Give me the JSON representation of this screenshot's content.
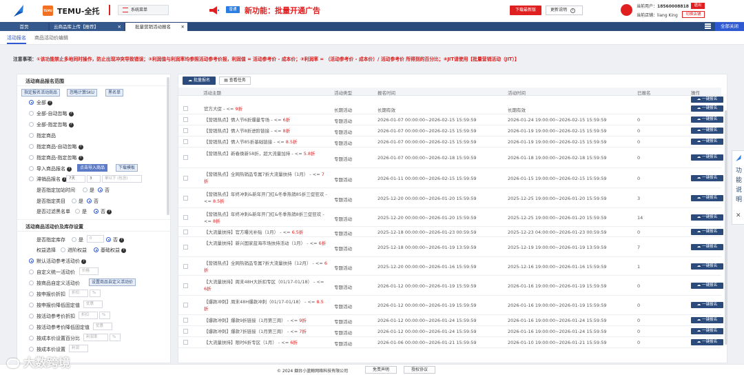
{
  "header": {
    "brand": "TEMU-全托",
    "logo_small": "TEMU",
    "system_menu": "系统菜单",
    "badge": "普通",
    "announcement": "新功能：批量开通广告",
    "download_btn": "下载最新版",
    "update_btn": "更新说明",
    "current_user_label": "当前用户：",
    "current_user": "18560008818",
    "logout_btn": "退出",
    "current_shop_label": "当前店铺：",
    "current_shop": "liang King",
    "switch_shop_btn": "切换店铺"
  },
  "tabs": [
    {
      "label": "首页"
    },
    {
      "label": "云商品库上传【推荐】"
    },
    {
      "label": "批量营销活动报名"
    }
  ],
  "close_all": "全部关闭",
  "subtabs": [
    "活动报名",
    "商品活动价编辑"
  ],
  "notice": {
    "label": "注意事项：",
    "text": "①该功能禁止多地同时操作，防止出现冲突导致错误；②利润值与利润率均参照活动参考价报，利润值 = 活动参考价 - 成本价；③利润率 = （活动参考价 - 成本价）/ 活动参考价 所得到的百分比；④JIT请使用【批量营销活动（JIT）】"
  },
  "left": {
    "section1": "活动商品报名范围",
    "btn_designated": "指定报名活动商品",
    "btn_ignore_sku": "忽略计算SKU",
    "btn_blacklist": "黑名单",
    "options": [
      "全部",
      "全部-自动忽略",
      "全部-指定忽略",
      "指定商品",
      "指定商品-自动忽略",
      "指定商品-指定忽略",
      "导入商品报名",
      "滞销品报名"
    ],
    "btn_import": "点击导入商品",
    "btn_template": "下载模板",
    "stale_days": "7天",
    "stale_num": "3",
    "stale_tip": "单以下 (包含)",
    "row_join_time": "是否指定加站时间",
    "row_category": "是否指定类目",
    "row_blacklist": "是否过滤黑名单",
    "yes": "是",
    "no": "否",
    "section2": "活动商品活动价及库存设置",
    "row_stock": "是否指定库存",
    "stock_value": "0",
    "row_rights": "权益选择",
    "rights_advanced": "进阶权益",
    "rights_basic": "基础权益",
    "price_options": [
      "默认活动参考活动价",
      "自定义统一活动价",
      "按商品自定义活动价",
      "按申报价折扣",
      "按申报价降低固定值",
      "按活动参考价折扣",
      "按活动参考价降低固定值",
      "按成本价设置百分比",
      "按成本价设置"
    ],
    "ph_price": "价格",
    "btn_custom_price": "设置商品自定义活动价",
    "ph_discount": "折扣",
    "ph_percent": "%",
    "ph_discount_amount": "优惠",
    "ph_profit": "利润率",
    "ph_profit2": "利润"
  },
  "right": {
    "btn_batch": "批量报名",
    "btn_view_task": "查看任务",
    "columns": [
      "活动主题",
      "活动类型",
      "报名时间",
      "活动时间",
      "已报名",
      "操作"
    ],
    "register_label": "一键报名",
    "rows": [
      {
        "theme": "官方大促 - <= ",
        "theme_red": "9折",
        "type": "长期活动",
        "reg": "长期有效",
        "act": "长期有效",
        "count": ""
      },
      {
        "theme": "【营销热点】情人节6折爆量专场 - <= ",
        "theme_red": "6折",
        "type": "专题活动",
        "reg": "2026-01-07 00:00:00~2026-02-15 15:59:59",
        "act": "2026-01-24 19:00:00~2026-02-15 15:59:59",
        "count": "0"
      },
      {
        "theme": "【营销热点】情人节8折进阶链接 - <= ",
        "theme_red": "8折",
        "type": "专题活动",
        "reg": "2026-01-07 00:00:00~2026-02-15 15:59:59",
        "act": "2026-01-19 19:00:00~2026-02-15 15:59:59",
        "count": "0"
      },
      {
        "theme": "【营销热点】情人节85折基础链接 - <= ",
        "theme_red": "8.5折",
        "type": "专题活动",
        "reg": "2026-01-07 00:00:00~2026-02-15 15:59:59",
        "act": "2026-01-19 19:00:00~2026-02-15 15:59:59",
        "count": "0"
      },
      {
        "theme": "【营销热点】新春焕新58折，超大流量加持 - <= ",
        "theme_red": "5.8折",
        "type": "专题活动",
        "reg": "2026-01-07 00:00:00~2026-02-18 15:59:59",
        "act": "2026-01-18 19:00:00~2026-02-18 15:59:59",
        "count": "0"
      },
      {
        "theme": "【营销热点】全网热销品专属7折大流量扶持（1月） - <= ",
        "theme_red": "7折",
        "type": "专题活动",
        "reg": "2026-01-11 00:00:00~2026-02-15 15:59:59",
        "act": "2026-01-15 19:00:00~2026-02-15 15:59:59",
        "count": "0"
      },
      {
        "theme": "【营销热点】年终冲刺&新年开门红&冬季热销85折三促狂欢 - <= ",
        "theme_red": "8.5折",
        "type": "专题活动",
        "reg": "2025-12-20 00:00:00~2026-01-20 15:59:59",
        "act": "2025-12-25 19:00:00~2026-01-20 15:59:59",
        "count": "3"
      },
      {
        "theme": "【营销热点】年终冲刺&新年开门红&冬季热销8折三促狂欢 - <= ",
        "theme_red": "8折",
        "type": "专题活动",
        "reg": "2025-12-20 00:00:00~2026-01-20 15:59:59",
        "act": "2025-12-25 19:00:00~2026-01-20 15:59:59",
        "count": "14"
      },
      {
        "theme": "【大流量扶持】官方曝光补贴（1月） - <= ",
        "theme_red": "6.5折",
        "type": "专题活动",
        "reg": "2025-12-18 00:00:00~2026-01-23 00:59:59",
        "act": "2025-12-23 04:00:00~2026-01-23 00:59:59",
        "count": "0"
      },
      {
        "theme": "【大流量扶持】新兴国家蓝海市场扶持活动（1月） - <= ",
        "theme_red": "6折",
        "type": "专题活动",
        "reg": "2025-12-18 00:00:00~2026-01-19 13:59:59",
        "act": "2025-12-19 19:00:00~2026-01-19 13:59:59",
        "count": "7"
      },
      {
        "theme": "【营销热点】全网热销品专属7折大流量扶持（12月） - <= ",
        "theme_red": "6折",
        "type": "专题活动",
        "reg": "2025-12-20 00:00:00~2026-01-16 15:59:59",
        "act": "2025-12-16 19:00:00~2026-01-16 15:59:59",
        "count": "1"
      },
      {
        "theme": "【大流量扶持】周末48H大折扣专区（01/17-01/18） - <= ",
        "theme_red": "6折",
        "type": "专题活动",
        "reg": "2026-01-12 00:00:00~2026-01-19 15:59:59",
        "act": "2026-01-16 19:00:00~2026-01-19 15:59:59",
        "count": "0"
      },
      {
        "theme": "【爆款冲刺】周末48H爆款冲刺（01/17-01/18） - <= ",
        "theme_red": "8.5折",
        "type": "专题活动",
        "reg": "2026-01-12 00:00:00~2026-01-19 15:59:59",
        "act": "2026-01-16 19:00:00~2026-01-19 15:59:59",
        "count": "0"
      },
      {
        "theme": "【爆款冲刺】爆款9折链接（1月第三周） - <= ",
        "theme_red": "9折",
        "type": "专题活动",
        "reg": "2026-01-12 00:00:00~2026-01-24 15:59:59",
        "act": "2026-01-16 19:00:00~2026-01-24 15:59:59",
        "count": "0"
      },
      {
        "theme": "【爆款冲刺】爆款7折链接（1月第三周） - <= ",
        "theme_red": "7折",
        "type": "专题活动",
        "reg": "2026-01-12 00:00:00~2026-01-24 15:59:59",
        "act": "2026-01-16 19:00:00~2026-01-24 15:59:59",
        "count": "0"
      },
      {
        "theme": "【大流量扶持】限时6折专区（1月） - <= ",
        "theme_red": "6折",
        "type": "专题活动",
        "reg": "2026-01-06 00:00:00~2026-01-21 15:59:59",
        "act": "2026-01-10 19:00:00~2026-01-21 15:59:59",
        "count": "0"
      }
    ]
  },
  "footer": {
    "copyright": "© 2024 烟台小蓝鲸网络科技有限公司",
    "disclaimer": "免责声明",
    "license": "授权协议"
  },
  "float_panel": [
    "功",
    "能",
    "说",
    "明"
  ],
  "watermark": "大数跨境",
  "colors": {
    "navy": "#2a4b7c",
    "red": "#d5201e",
    "blue": "#2f59d1"
  }
}
